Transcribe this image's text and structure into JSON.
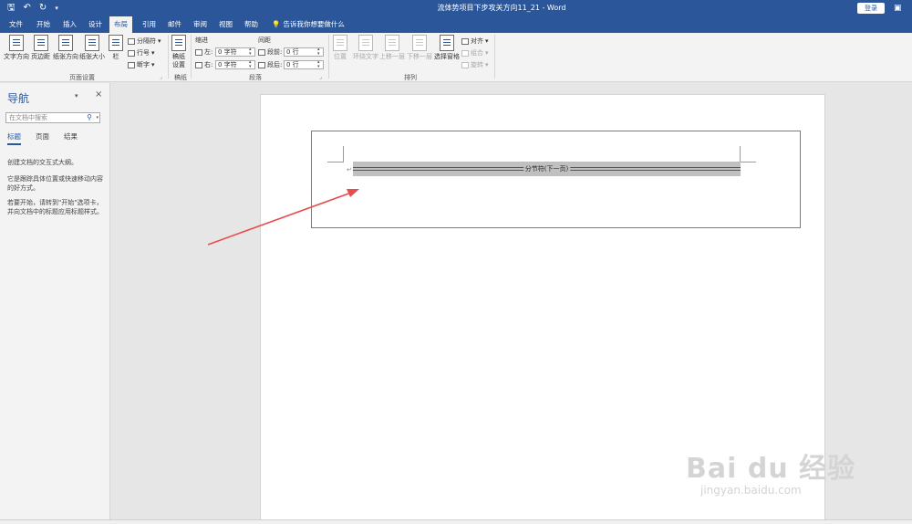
{
  "titlebar": {
    "title": "流体势项目下步攻关方向11_21  -  Word",
    "signin": "登录",
    "qat_icons": [
      "save-icon",
      "undo-icon",
      "redo-icon",
      "customize-icon"
    ]
  },
  "tabs": {
    "file": "文件",
    "home": "开始",
    "insert": "插入",
    "design": "设计",
    "layout": "布局",
    "references": "引用",
    "mailings": "邮件",
    "review": "审阅",
    "view": "视图",
    "help": "帮助",
    "tellme": "告诉我你想要做什么"
  },
  "ribbon": {
    "page_setup": {
      "label": "页面设置",
      "text_direction": "文字方向",
      "margins": "页边距",
      "orientation": "纸张方向",
      "size": "纸张大小",
      "columns": "栏",
      "breaks": "分隔符",
      "line_numbers": "行号",
      "hyphenation": "断字"
    },
    "draft": {
      "label": "稿纸",
      "draft_settings": "稿纸\n设置"
    },
    "paragraph": {
      "label": "段落",
      "indent": "缩进",
      "spacing": "间距",
      "left": "左:",
      "right": "右:",
      "before": "段前:",
      "after": "段后:",
      "left_value": "0 字符",
      "right_value": "0 字符",
      "before_value": "0 行",
      "after_value": "0 行"
    },
    "arrange": {
      "label": "排列",
      "position": "位置",
      "wrap_text": "环绕文字",
      "bring_forward": "上移一层",
      "send_backward": "下移一层",
      "selection_pane": "选择窗格",
      "align": "对齐",
      "group": "组合",
      "rotate": "旋转"
    }
  },
  "nav": {
    "title": "导航",
    "search_placeholder": "在文档中搜索",
    "tab_headings": "标题",
    "tab_pages": "页面",
    "tab_results": "结果",
    "text1": "创建文档的交互式大纲。",
    "text2": "它是跟踪具体位置或快速移动内容的好方式。",
    "text3": "若要开始，请转到\"开始\"选项卡，并向文档中的标题应用标题样式。"
  },
  "document": {
    "para_mark": "↵",
    "section_break": "分节符(下一页)"
  },
  "watermark": {
    "main": "Bai du 经验",
    "sub": "jingyan.baidu.com"
  },
  "colors": {
    "accent": "#2b579a",
    "annotation": "#e84c4c"
  }
}
